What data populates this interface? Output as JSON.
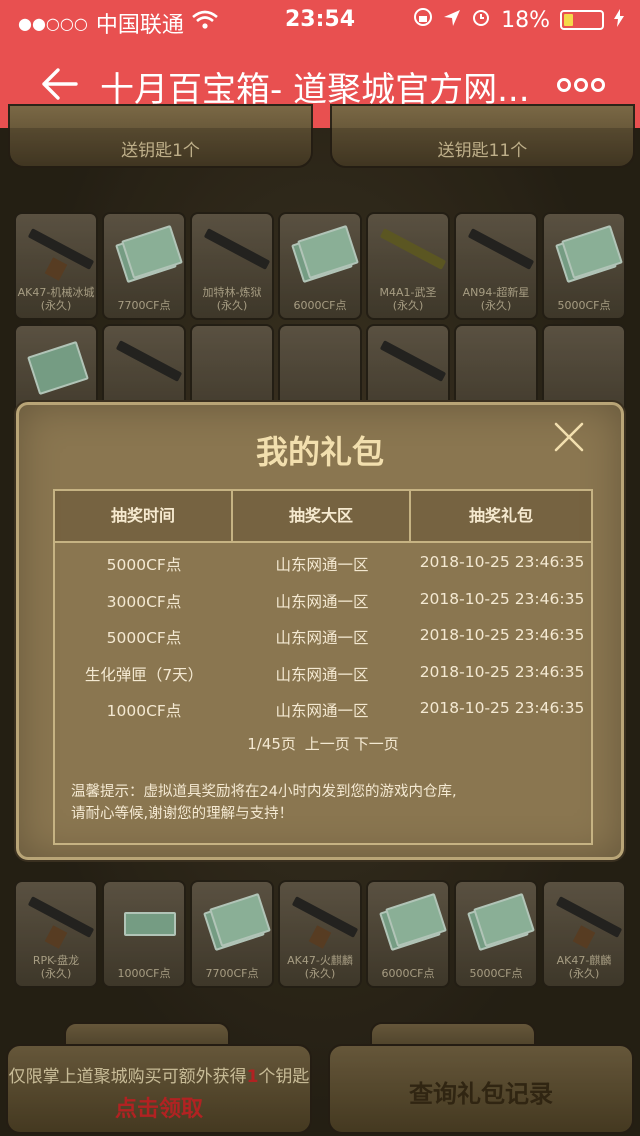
{
  "status": {
    "carrier": "中国联通",
    "time": "23:54",
    "battery": "18%"
  },
  "nav": {
    "title": "十月百宝箱- 道聚城官方网..."
  },
  "bg": {
    "top_left_sub": "送钥匙1个",
    "top_right_sub": "送钥匙11个",
    "row1": [
      {
        "label": "AK47-机械冰城\n(永久)"
      },
      {
        "label": "7700CF点"
      },
      {
        "label": "加特林-炼狱\n(永久)"
      },
      {
        "label": "6000CF点"
      },
      {
        "label": "M4A1-武圣\n(永久)"
      },
      {
        "label": "AN94-超新星\n(永久)"
      },
      {
        "label": "5000CF点"
      }
    ],
    "row3": [
      {
        "label": "RPK-盘龙\n(永久)"
      },
      {
        "label": "1000CF点"
      },
      {
        "label": "7700CF点"
      },
      {
        "label": "AK47-火麒麟\n(永久)"
      },
      {
        "label": "6000CF点"
      },
      {
        "label": "5000CF点"
      },
      {
        "label": "AK47-麒麟\n(永久)"
      }
    ],
    "bottom_left_line1_pre": "仅限掌上道聚城购买可额外获得",
    "bottom_left_line1_num": "1",
    "bottom_left_line1_post": "个钥匙",
    "bottom_left_line2": "点击领取",
    "bottom_right": "查询礼包记录"
  },
  "modal": {
    "title": "我的礼包",
    "headers": [
      "抽奖时间",
      "抽奖大区",
      "抽奖礼包"
    ],
    "rows": [
      {
        "c1": "5000CF点",
        "c2": "山东网通一区",
        "c3": "2018-10-25 23:46:35"
      },
      {
        "c1": "3000CF点",
        "c2": "山东网通一区",
        "c3": "2018-10-25 23:46:35"
      },
      {
        "c1": "5000CF点",
        "c2": "山东网通一区",
        "c3": "2018-10-25 23:46:35"
      },
      {
        "c1": "生化弹匣（7天）",
        "c2": "山东网通一区",
        "c3": "2018-10-25 23:46:35"
      },
      {
        "c1": "1000CF点",
        "c2": "山东网通一区",
        "c3": "2018-10-25 23:46:35"
      }
    ],
    "pager": {
      "page_info": "1/45页",
      "prev": "上一页",
      "next": "下一页"
    },
    "notice_line1": "温馨提示：虚拟道具奖励将在24小时内发到您的游戏内仓库,",
    "notice_line2": "请耐心等候,谢谢您的理解与支持！"
  }
}
